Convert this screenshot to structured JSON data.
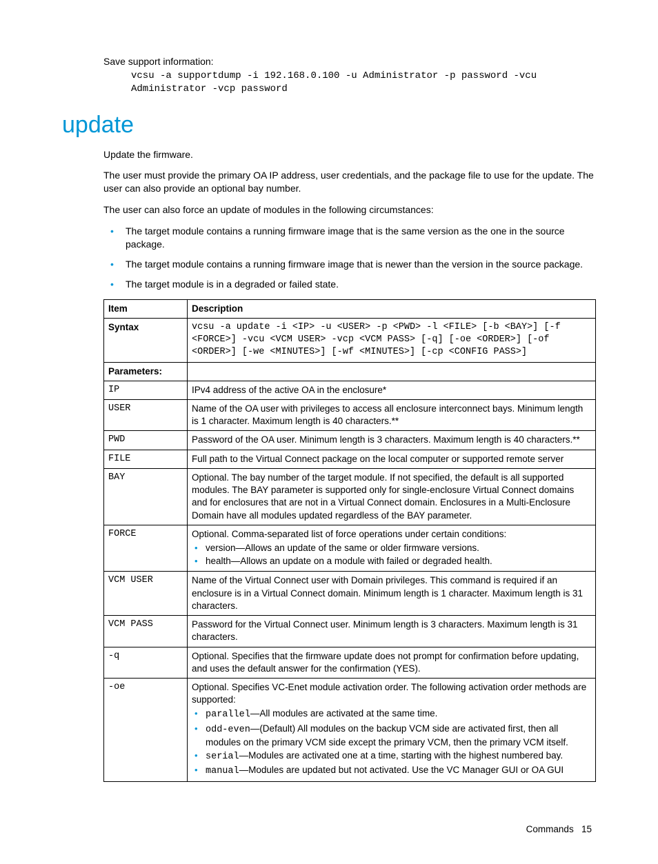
{
  "intro": {
    "save_label": "Save support information:",
    "code_line1": "vcsu -a supportdump -i 192.168.0.100 -u Administrator -p password -vcu",
    "code_line2": "Administrator -vcp password"
  },
  "heading": "update",
  "paragraphs": {
    "p1": "Update the firmware.",
    "p2": "The user must provide the primary OA IP address, user credentials, and the package file to use for the update. The user can also provide an optional bay number.",
    "p3": "The user can also force an update of modules in the following circumstances:"
  },
  "circumstances": [
    "The target module contains a running firmware image that is the same version as the one in the source package.",
    "The target module contains a running firmware image that is newer than the version in the source package.",
    "The target module is in a degraded or failed state."
  ],
  "table": {
    "header_item": "Item",
    "header_desc": "Description",
    "syntax_label": "Syntax",
    "syntax_l1": "vcsu -a update -i <IP> -u <USER> -p <PWD> -l <FILE> [-b <BAY>] [-f",
    "syntax_l2": "<FORCE>] -vcu <VCM USER> -vcp <VCM PASS> [-q] [-oe <ORDER>] [-of",
    "syntax_l3": "<ORDER>] [-we <MINUTES>] [-wf <MINUTES>] [-cp <CONFIG PASS>]",
    "params_label": "Parameters:",
    "rows": {
      "ip": {
        "k": "IP",
        "v": "IPv4 address of the active OA in the enclosure*"
      },
      "user": {
        "k": "USER",
        "v": "Name of the OA user with privileges to access all enclosure interconnect bays. Minimum length is 1 character. Maximum length is 40 characters.**"
      },
      "pwd": {
        "k": "PWD",
        "v": "Password of the OA user. Minimum length is 3 characters. Maximum length is 40 characters.**"
      },
      "file": {
        "k": "FILE",
        "v": "Full path to the Virtual Connect package on the local computer or supported remote server"
      },
      "bay": {
        "k": "BAY",
        "v": "Optional. The bay number of the target module. If not specified, the default is all supported modules. The BAY parameter is supported only for single-enclosure Virtual Connect domains and for enclosures that are not in a Virtual Connect domain. Enclosures in a Multi-Enclosure Domain have all modules updated regardless of the BAY parameter."
      },
      "force": {
        "k": "FORCE",
        "intro": "Optional. Comma-separated list of force operations under certain conditions:",
        "b1": "version—Allows an update of the same or older firmware versions.",
        "b2": "health—Allows an update on a module with failed or degraded health."
      },
      "vcmu": {
        "k": "VCM USER",
        "v": "Name of the Virtual Connect user with Domain privileges. This command is required if an enclosure is in a Virtual Connect domain. Minimum length is 1 character. Maximum length is 31 characters."
      },
      "vcmp": {
        "k": "VCM PASS",
        "v": "Password for the Virtual Connect user. Minimum length is 3 characters. Maximum length is 31 characters."
      },
      "q": {
        "k": "-q",
        "v": "Optional. Specifies that the firmware update does not prompt for confirmation before updating, and uses the default answer for the confirmation (YES)."
      },
      "oe": {
        "k": "-oe",
        "intro": "Optional. Specifies VC-Enet module activation order. The following activation order methods are supported:",
        "b1_code": "parallel",
        "b1_rest": "—All modules are activated at the same time.",
        "b2_code": "odd-even",
        "b2_rest": "—(Default) All modules on the backup VCM side are activated first, then all modules on the primary VCM side except the primary VCM, then the primary VCM itself.",
        "b3_code": "serial",
        "b3_rest": "—Modules are activated one at a time, starting with the highest numbered bay.",
        "b4_code": "manual",
        "b4_rest": "—Modules are updated but not activated. Use the VC Manager GUI or OA GUI"
      }
    }
  },
  "footer": {
    "section": "Commands",
    "page": "15"
  }
}
